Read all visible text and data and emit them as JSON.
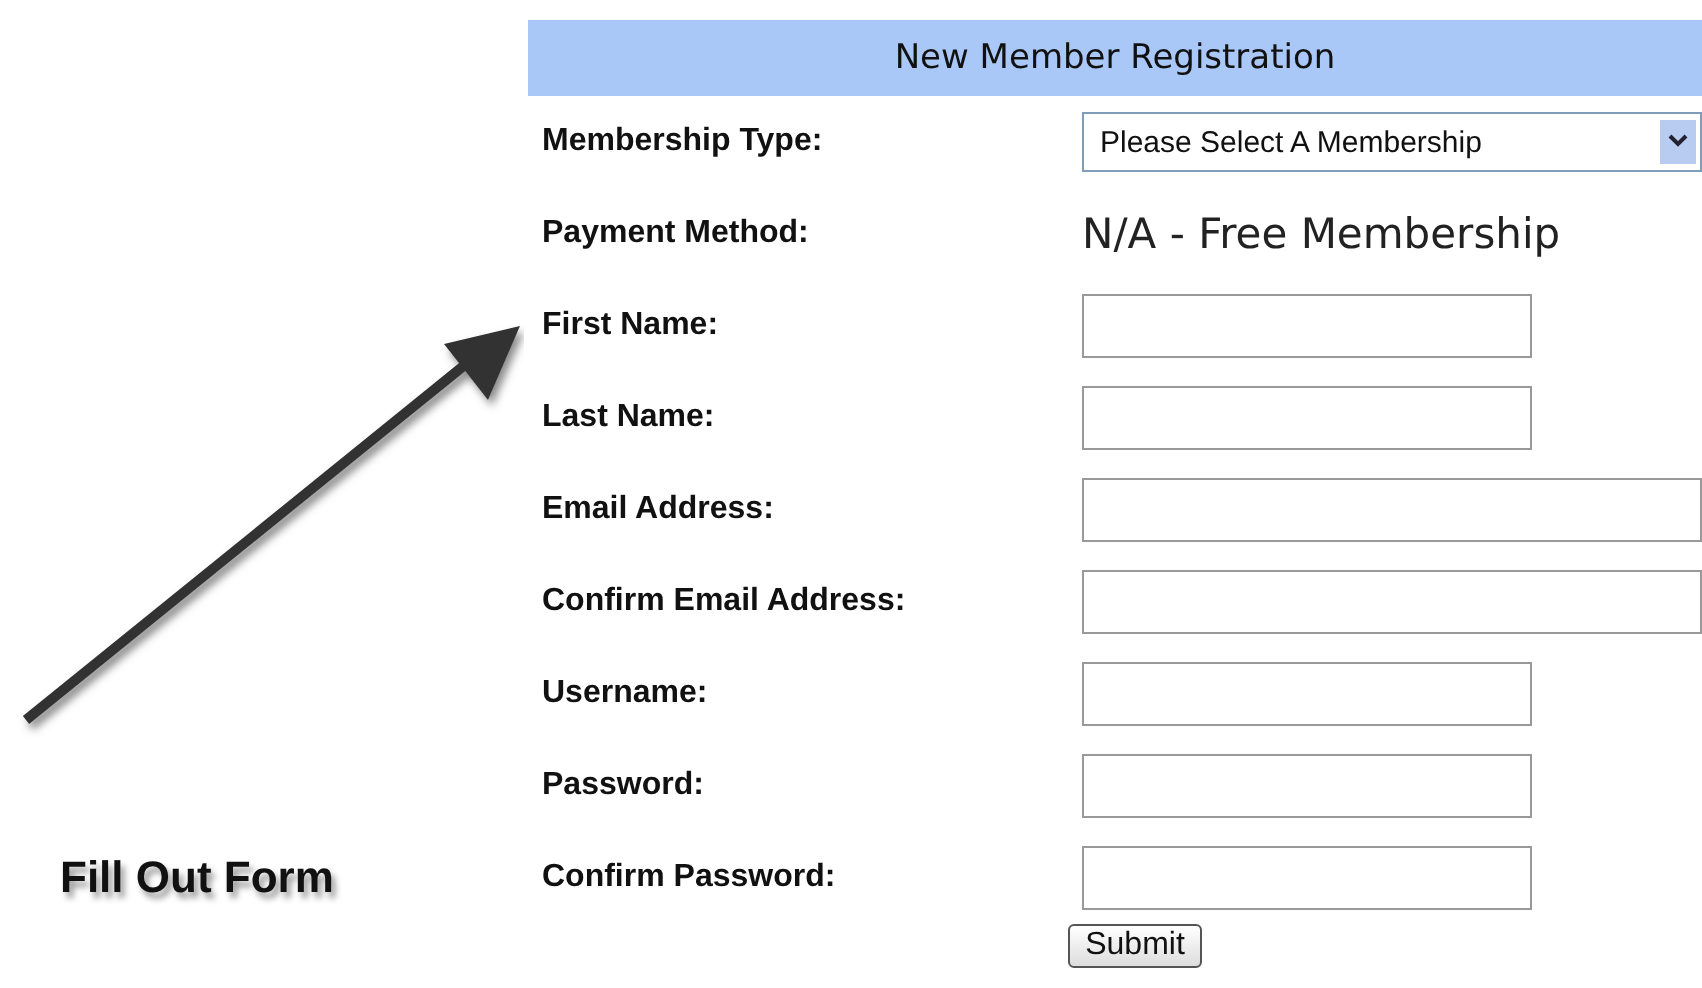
{
  "annotation": {
    "text": "Fill Out Form"
  },
  "form": {
    "title": "New Member Registration",
    "rows": [
      {
        "label": "Membership Type:",
        "kind": "select",
        "value": "Please Select A Membership"
      },
      {
        "label": "Payment Method:",
        "kind": "static",
        "value": "N/A - Free Membership"
      },
      {
        "label": "First Name:",
        "kind": "text"
      },
      {
        "label": "Last Name:",
        "kind": "text"
      },
      {
        "label": "Email Address:",
        "kind": "wide"
      },
      {
        "label": "Confirm Email Address:",
        "kind": "wide"
      },
      {
        "label": "Username:",
        "kind": "text"
      },
      {
        "label": "Password:",
        "kind": "text"
      },
      {
        "label": "Confirm Password:",
        "kind": "text"
      }
    ],
    "submit": "Submit"
  }
}
